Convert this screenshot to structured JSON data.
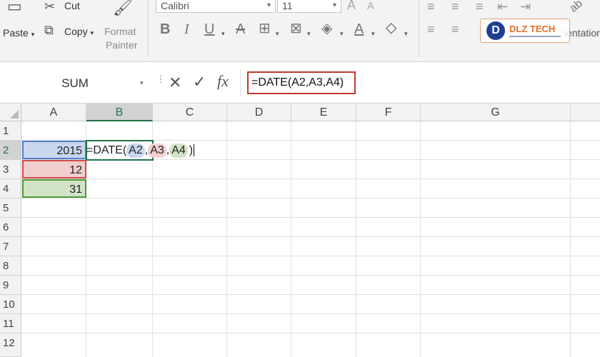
{
  "ribbon": {
    "paste_label": "Paste",
    "cut_label": "Cut",
    "copy_label": "Copy",
    "format_painter_line1": "Format",
    "format_painter_line2": "Painter",
    "font_name": "Calibri",
    "font_size": "11",
    "orientation_fragment": "ientation",
    "watermark_text": "DLZ TECH"
  },
  "formula_bar": {
    "name_box": "SUM",
    "cancel_glyph": "✕",
    "enter_glyph": "✓",
    "fx_label": "fx",
    "formula": "=DATE(A2,A3,A4)"
  },
  "columns": [
    "A",
    "B",
    "C",
    "D",
    "E",
    "F",
    "G"
  ],
  "rows": [
    "1",
    "2",
    "3",
    "4",
    "5",
    "6",
    "7",
    "8",
    "9",
    "10",
    "11",
    "12"
  ],
  "cells": {
    "A2": "2015",
    "A3": "12",
    "A4": "31"
  },
  "editing_cell": {
    "prefix": "=DATE(",
    "ref1": "A2",
    "sep1": ",",
    "ref2": "A3",
    "sep2": ",",
    "ref3": "A4",
    "suffix": ")"
  },
  "colors": {
    "ref_a2": "#c9d7ef",
    "ref_a3": "#f2cfcf",
    "ref_a4": "#d3e3c7",
    "excel_green": "#217346",
    "highlight_red": "#c0392b"
  }
}
